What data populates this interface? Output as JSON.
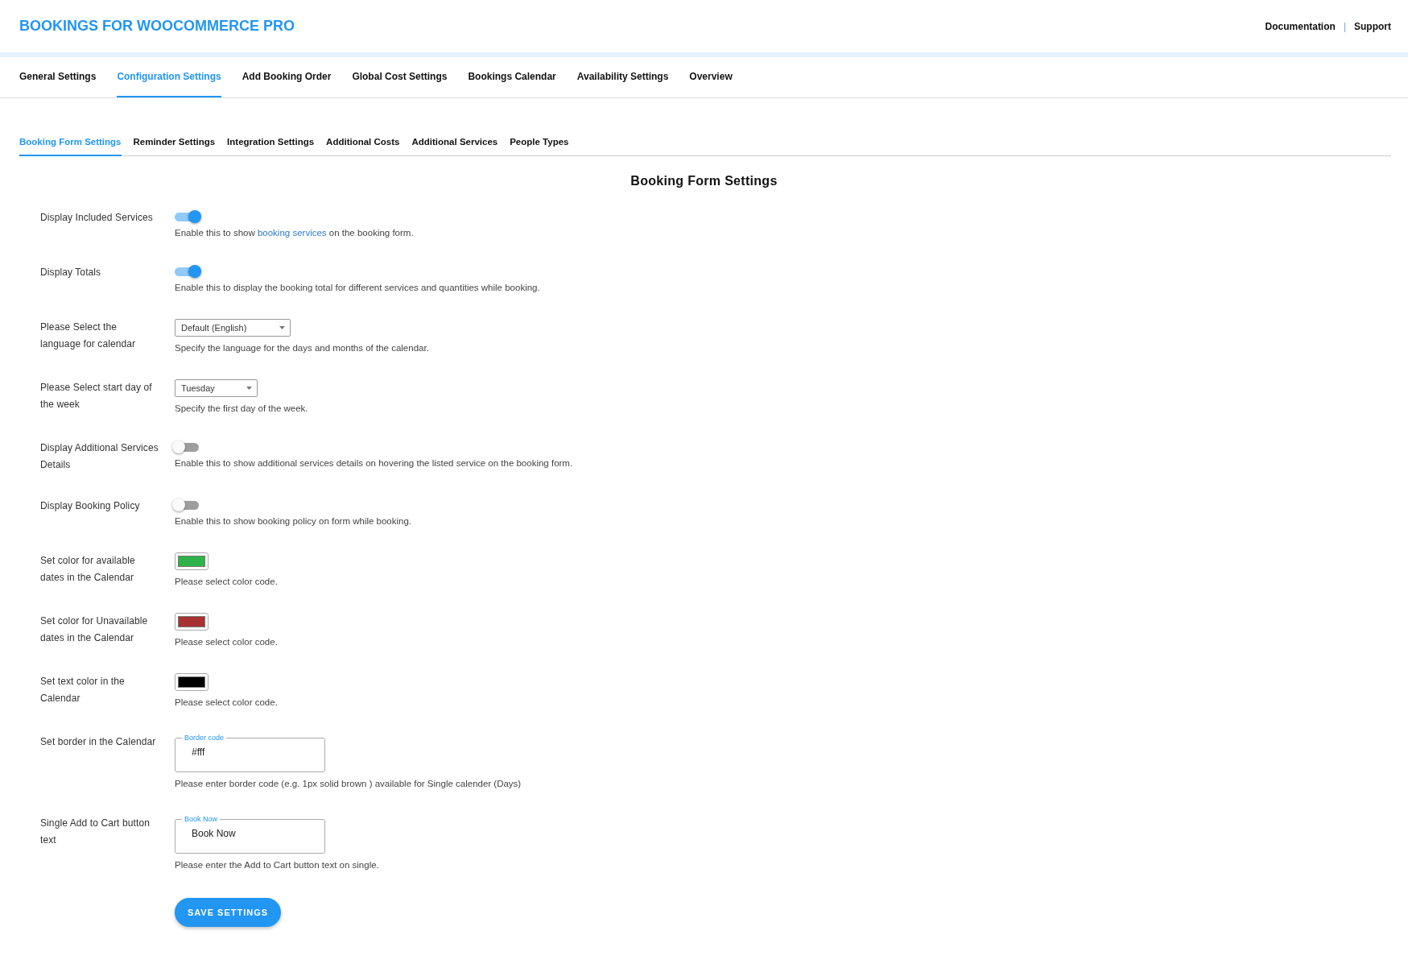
{
  "header": {
    "title": "BOOKINGS FOR WOOCOMMERCE PRO",
    "links": [
      "Documentation",
      "Support"
    ],
    "separator": "|"
  },
  "main_tabs": [
    {
      "label": "General Settings",
      "selected": false
    },
    {
      "label": "Configuration Settings",
      "selected": true
    },
    {
      "label": "Add Booking Order",
      "selected": false
    },
    {
      "label": "Global Cost Settings",
      "selected": false
    },
    {
      "label": "Bookings Calendar",
      "selected": false
    },
    {
      "label": "Availability Settings",
      "selected": false
    },
    {
      "label": "Overview",
      "selected": false
    }
  ],
  "sub_tabs": [
    {
      "label": "Booking Form Settings",
      "selected": true
    },
    {
      "label": "Reminder Settings",
      "selected": false
    },
    {
      "label": "Integration Settings",
      "selected": false
    },
    {
      "label": "Additional Costs",
      "selected": false
    },
    {
      "label": "Additional Services",
      "selected": false
    },
    {
      "label": "People Types",
      "selected": false
    }
  ],
  "form": {
    "heading": "Booking Form Settings",
    "rows": [
      {
        "kind": "toggle",
        "label": "Display Included Services",
        "on": true,
        "description": [
          {
            "text": "Enable this to show ",
            "kind": "text"
          },
          {
            "text": "booking services",
            "kind": "link"
          },
          {
            "text": " on the booking form.",
            "kind": "text"
          }
        ]
      },
      {
        "kind": "toggle",
        "label": "Display Totals",
        "on": true,
        "description": [
          {
            "text": "Enable this to display the booking total for different services and quantities while booking.",
            "kind": "text"
          }
        ]
      },
      {
        "kind": "select",
        "label": "Please Select the language for calendar",
        "value": "Default (English)",
        "description": [
          {
            "text": "Specify the language for the days and months of the calendar.",
            "kind": "text"
          }
        ]
      },
      {
        "kind": "select",
        "label": "Please Select start day of the week",
        "value": "Tuesday",
        "description": [
          {
            "text": "Specify the first day of the week.",
            "kind": "text"
          }
        ]
      },
      {
        "kind": "toggle",
        "label": "Display Additional Services Details",
        "on": false,
        "description": [
          {
            "text": "Enable this to show additional services details on hovering the listed service on the booking form.",
            "kind": "text"
          }
        ]
      },
      {
        "kind": "toggle",
        "label": "Display Booking Policy",
        "on": false,
        "description": [
          {
            "text": "Enable this to show booking policy on form while booking.",
            "kind": "text"
          }
        ]
      },
      {
        "kind": "color",
        "label": "Set color for available dates in the Calendar",
        "color": "#2db34a",
        "description": [
          {
            "text": "Please select color code.",
            "kind": "text"
          }
        ]
      },
      {
        "kind": "color",
        "label": "Set color for Unavailable dates in the Calendar",
        "color": "#a83232",
        "description": [
          {
            "text": "Please select color code.",
            "kind": "text"
          }
        ]
      },
      {
        "kind": "color",
        "label": "Set text color in the Calendar",
        "color": "#000000",
        "description": [
          {
            "text": "Please select color code.",
            "kind": "text"
          }
        ]
      },
      {
        "kind": "text",
        "label": "Set border in the Calendar",
        "floating_label": "Border code",
        "value": "#fff",
        "description": [
          {
            "text": "Please enter border code (e.g. 1px solid brown ) available for Single calender (Days)",
            "kind": "text"
          }
        ]
      },
      {
        "kind": "text",
        "label": "Single Add to Cart button text",
        "floating_label": "Book Now",
        "value": "Book Now",
        "description": [
          {
            "text": "Please enter the Add to Cart button text on single.",
            "kind": "text"
          }
        ]
      }
    ],
    "save_button": "SAVE SETTINGS"
  }
}
